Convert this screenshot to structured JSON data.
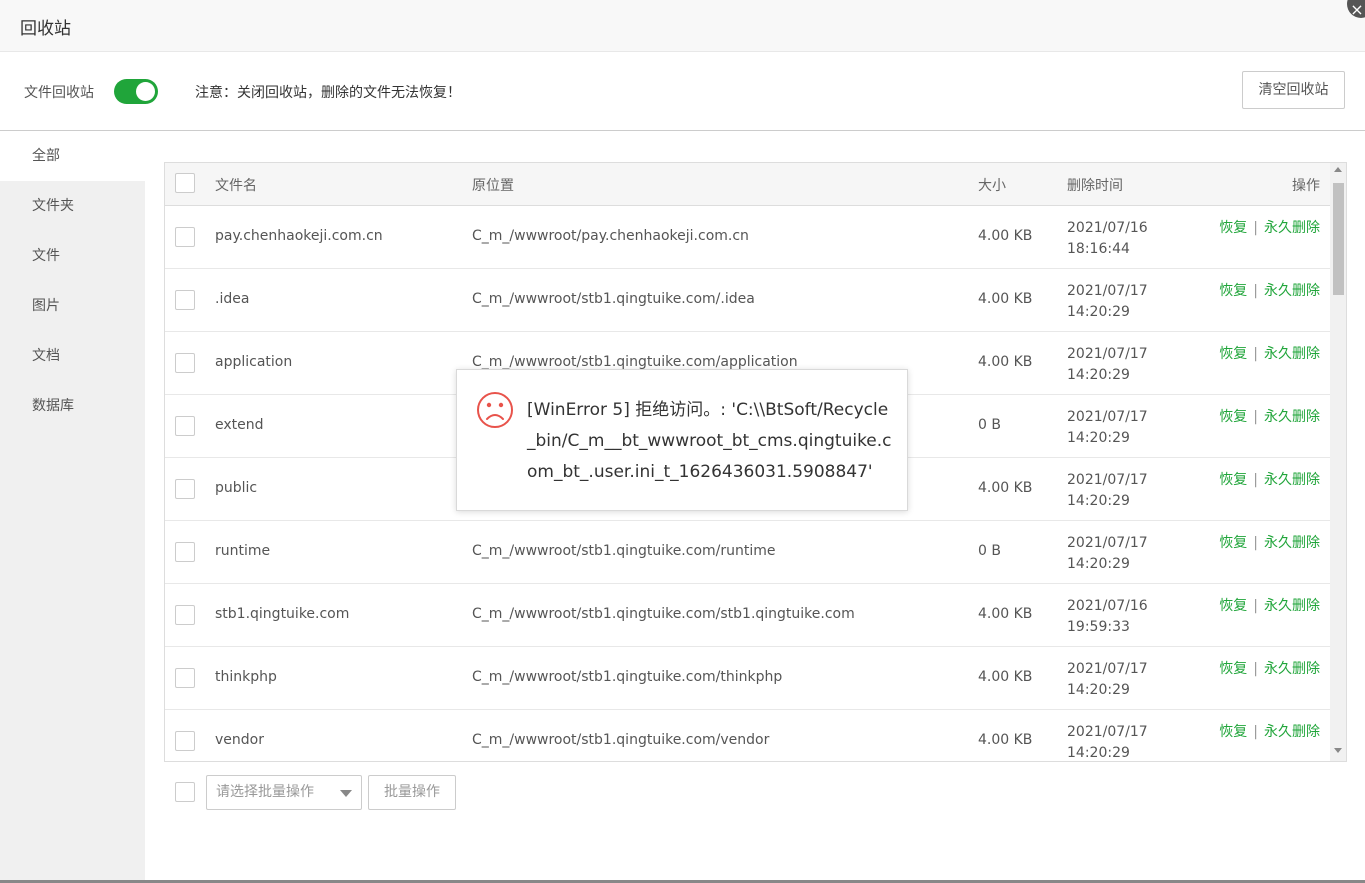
{
  "window": {
    "title": "回收站",
    "close_icon": "×"
  },
  "toolbar": {
    "toggle_label": "文件回收站",
    "toggle_on": true,
    "notice": "注意：关闭回收站，删除的文件无法恢复！",
    "clear_button": "清空回收站"
  },
  "sidebar": {
    "items": [
      {
        "label": "全部",
        "active": true
      },
      {
        "label": "文件夹"
      },
      {
        "label": "文件"
      },
      {
        "label": "图片"
      },
      {
        "label": "文档"
      },
      {
        "label": "数据库"
      }
    ]
  },
  "table": {
    "headers": {
      "name": "文件名",
      "location": "原位置",
      "size": "大小",
      "time": "删除时间",
      "ops": "操作"
    },
    "rows": [
      {
        "name": "pay.chenhaokeji.com.cn",
        "location": "C_m_/wwwroot/pay.chenhaokeji.com.cn",
        "size": "4.00 KB",
        "date": "2021/07/16",
        "time": "18:16:44"
      },
      {
        "name": ".idea",
        "location": "C_m_/wwwroot/stb1.qingtuike.com/.idea",
        "size": "4.00 KB",
        "date": "2021/07/17",
        "time": "14:20:29"
      },
      {
        "name": "application",
        "location": "C_m_/wwwroot/stb1.qingtuike.com/application",
        "size": "4.00 KB",
        "date": "2021/07/17",
        "time": "14:20:29"
      },
      {
        "name": "extend",
        "location": "",
        "size": "0 B",
        "date": "2021/07/17",
        "time": "14:20:29"
      },
      {
        "name": "public",
        "location": "",
        "size": "4.00 KB",
        "date": "2021/07/17",
        "time": "14:20:29"
      },
      {
        "name": "runtime",
        "location": "C_m_/wwwroot/stb1.qingtuike.com/runtime",
        "size": "0 B",
        "date": "2021/07/17",
        "time": "14:20:29"
      },
      {
        "name": "stb1.qingtuike.com",
        "location": "C_m_/wwwroot/stb1.qingtuike.com/stb1.qingtuike.com",
        "size": "4.00 KB",
        "date": "2021/07/16",
        "time": "19:59:33"
      },
      {
        "name": "thinkphp",
        "location": "C_m_/wwwroot/stb1.qingtuike.com/thinkphp",
        "size": "4.00 KB",
        "date": "2021/07/17",
        "time": "14:20:29"
      },
      {
        "name": "vendor",
        "location": "C_m_/wwwroot/stb1.qingtuike.com/vendor",
        "size": "4.00 KB",
        "date": "2021/07/17",
        "time": "14:20:29"
      }
    ],
    "action_restore": "恢复",
    "action_separator": "|",
    "action_delete": "永久删除"
  },
  "batch": {
    "select_placeholder": "请选择批量操作",
    "button": "批量操作"
  },
  "popup": {
    "icon": "sad-face-icon",
    "message": "[WinError 5] 拒绝访问。: 'C:\\\\BtSoft/Recycle_bin/C_m__bt_wwwroot_bt_cms.qingtuike.com_bt_.user.ini_t_1626436031.5908847'"
  },
  "colors": {
    "accent": "#20a53a",
    "error": "#e8534b"
  }
}
